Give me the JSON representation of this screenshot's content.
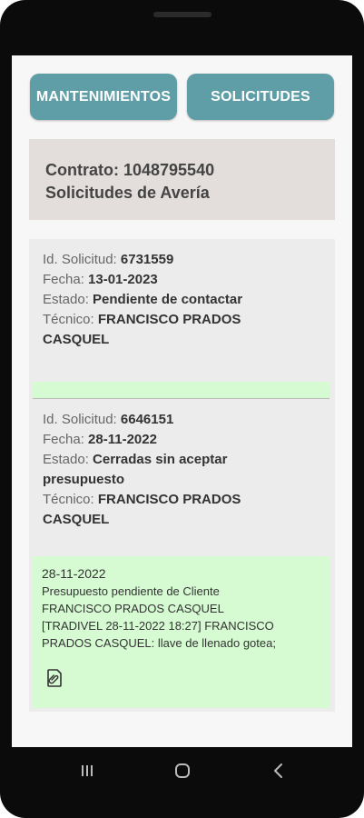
{
  "buttons": {
    "maintenance": "MANTENIMIENTOS",
    "requests": "SOLICITUDES"
  },
  "contract": {
    "line1": "Contrato: 1048795540",
    "line2": "Solicitudes de Avería"
  },
  "requests": [
    {
      "id_label": "Id. Solicitud:",
      "id_value": "6731559",
      "date_label": "Fecha:",
      "date_value": "13-01-2023",
      "status_label": "Estado:",
      "status_value": "Pendiente de contactar",
      "tech_label": "Técnico:",
      "tech_value": "FRANCISCO PRADOS CASQUEL"
    },
    {
      "id_label": "Id. Solicitud:",
      "id_value": "6646151",
      "date_label": "Fecha:",
      "date_value": "28-11-2022",
      "status_label": "Estado:",
      "status_value": "Cerradas sin aceptar presupuesto",
      "tech_label": "Técnico:",
      "tech_value": "FRANCISCO PRADOS CASQUEL",
      "note": {
        "date": "28-11-2022",
        "line1": "Presupuesto pendiente de Cliente",
        "line2": "FRANCISCO PRADOS CASQUEL",
        "line3": "[TRADIVEL 28-11-2022 18:27] FRANCISCO PRADOS CASQUEL: llave de llenado gotea;"
      }
    }
  ],
  "icons": {
    "attachment": "paperclip-document-icon",
    "nav": [
      "recents-icon",
      "home-icon",
      "back-icon"
    ]
  },
  "colors": {
    "button": "#5f9ea6",
    "note_bg": "#d6fbd2",
    "contract_bg": "#e3dedc"
  }
}
